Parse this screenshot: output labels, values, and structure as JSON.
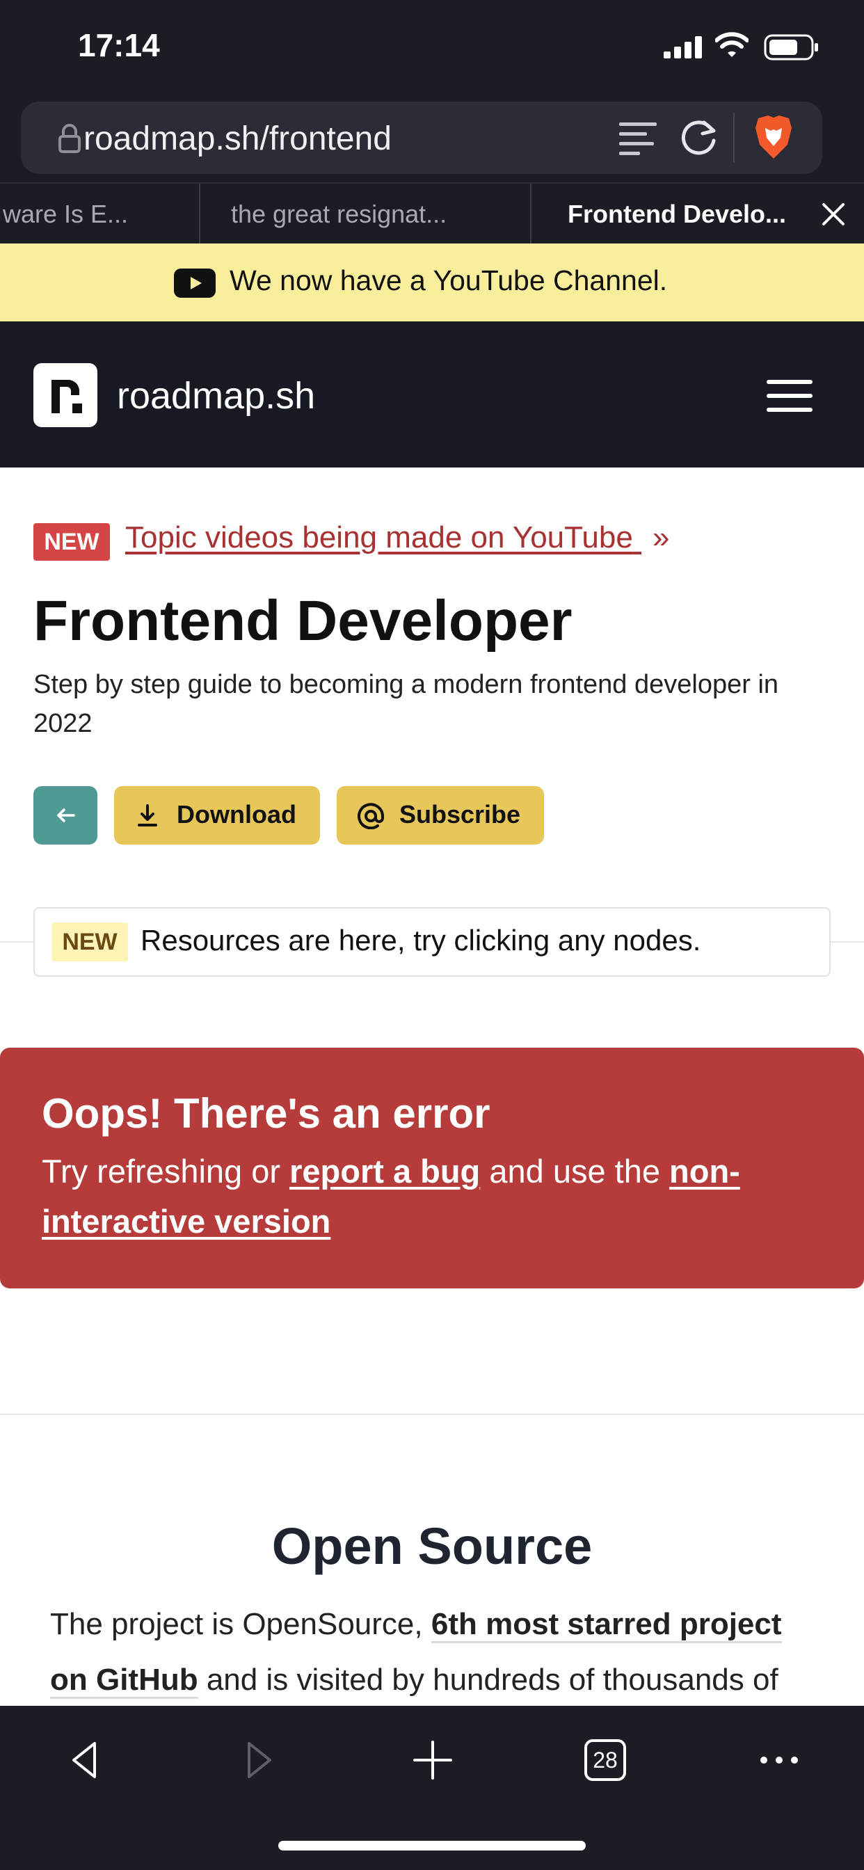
{
  "status_bar": {
    "time": "17:14"
  },
  "browser": {
    "url": "roadmap.sh/frontend",
    "tabs": [
      {
        "label": "ware Is E..."
      },
      {
        "label": "the great resignat..."
      },
      {
        "label": "Frontend Develo..."
      }
    ],
    "tab_count": "28",
    "colors": {
      "chrome_bg": "#1c1c24",
      "urlbar_bg": "#2b2c35",
      "brave_orange": "#f25a29"
    }
  },
  "banner": {
    "text": "We now have a YouTube Channel.",
    "bg": "#f8ee9c"
  },
  "header": {
    "logo_letter": "r.",
    "site_name": "roadmap.sh"
  },
  "announcement": {
    "badge": "NEW",
    "link_text": "Topic videos being made on YouTube",
    "suffix": "»"
  },
  "page": {
    "title": "Frontend Developer",
    "description": "Step by step guide to becoming a modern frontend developer in 2022"
  },
  "actions": {
    "download_label": "Download",
    "subscribe_label": "Subscribe"
  },
  "resources_notice": {
    "badge": "NEW",
    "text": "Resources are here, try clicking any nodes."
  },
  "error": {
    "title": "Oops! There's an error",
    "prefix": "Try refreshing or ",
    "report_link": "report a bug",
    "middle": " and use the ",
    "noninteractive_link_part1": "non-",
    "noninteractive_link_part2": "interactive version",
    "bg": "#b53c3a"
  },
  "open_source": {
    "title": "Open Source",
    "line1_prefix": "The project is OpenSource, ",
    "line1_strong": "6th most starred project",
    "line2_strong": "on GitHub",
    "line2_suffix": " and is visited by hundreds of thousands of"
  }
}
